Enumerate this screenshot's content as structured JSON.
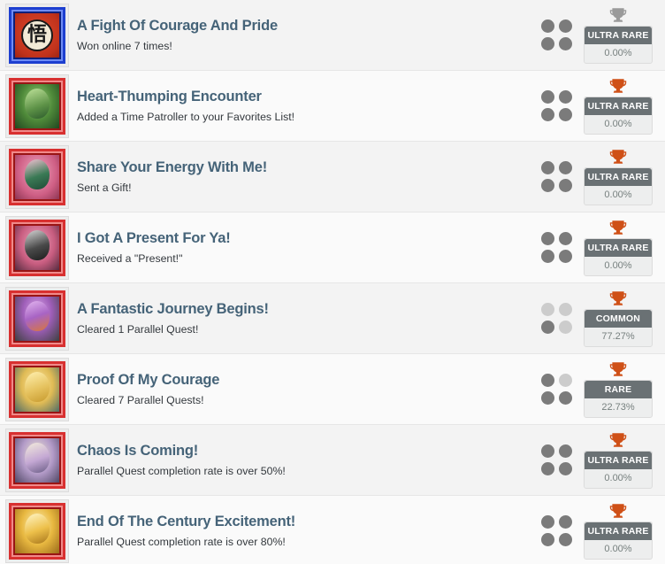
{
  "list": {
    "name": "trophy-achievement-list",
    "rows": [
      {
        "title": "A Fight Of Courage And Pride",
        "description": "Won online 7 times!",
        "rarity_label": "ULTRA RARE",
        "percent": "0.00%",
        "trophy_color": "#9a9a9a",
        "trophy_state": "locked",
        "dots": [
          true,
          true,
          true,
          true
        ],
        "icon_name": "goku-kanji-thumbnail"
      },
      {
        "title": "Heart-Thumping Encounter",
        "description": "Added a Time Patroller to your Favorites List!",
        "rarity_label": "ULTRA RARE",
        "percent": "0.00%",
        "trophy_color": "#cf5017",
        "trophy_state": "bronze",
        "dots": [
          true,
          true,
          true,
          true
        ],
        "icon_name": "piccolo-thumbnail"
      },
      {
        "title": "Share Your Energy With Me!",
        "description": "Sent a Gift!",
        "rarity_label": "ULTRA RARE",
        "percent": "0.00%",
        "trophy_color": "#cf5017",
        "trophy_state": "bronze",
        "dots": [
          true,
          true,
          true,
          true
        ],
        "icon_name": "great-saiyaman-thumbnail"
      },
      {
        "title": "I Got A Present For Ya!",
        "description": "Received a \"Present!\"",
        "rarity_label": "ULTRA RARE",
        "percent": "0.00%",
        "trophy_color": "#cf5017",
        "trophy_state": "bronze",
        "dots": [
          true,
          true,
          true,
          true
        ],
        "icon_name": "masked-fighter-thumbnail"
      },
      {
        "title": "A Fantastic Journey Begins!",
        "description": "Cleared 1 Parallel Quest!",
        "rarity_label": "COMMON",
        "percent": "77.27%",
        "trophy_color": "#cf5017",
        "trophy_state": "bronze",
        "dots": [
          false,
          false,
          true,
          false
        ],
        "icon_name": "trunks-thumbnail"
      },
      {
        "title": "Proof Of My Courage",
        "description": "Cleared 7 Parallel Quests!",
        "rarity_label": "RARE",
        "percent": "22.73%",
        "trophy_color": "#cf5017",
        "trophy_state": "bronze",
        "dots": [
          true,
          false,
          true,
          true
        ],
        "icon_name": "super-saiyan-thumbnail"
      },
      {
        "title": "Chaos Is Coming!",
        "description": "Parallel Quest completion rate is over 50%!",
        "rarity_label": "ULTRA RARE",
        "percent": "0.00%",
        "trophy_color": "#cf5017",
        "trophy_state": "bronze",
        "dots": [
          true,
          true,
          true,
          true
        ],
        "icon_name": "chaos-fighter-thumbnail"
      },
      {
        "title": "End Of The Century Excitement!",
        "description": "Parallel Quest completion rate is over 80%!",
        "rarity_label": "ULTRA RARE",
        "percent": "0.00%",
        "trophy_color": "#cf5017",
        "trophy_state": "bronze",
        "dots": [
          true,
          true,
          true,
          true
        ],
        "icon_name": "golden-fighter-thumbnail"
      }
    ]
  },
  "theme": {
    "row_bg_light": "#fafafa",
    "row_bg_alt": "#f3f3f3",
    "title_color": "#456378",
    "desc_color": "#33383d",
    "badge_bg": "#6a7174",
    "badge_text": "#ffffff",
    "percent_color": "#77807f",
    "dot_on": "#7b7b7b",
    "dot_off": "#cccccc"
  }
}
